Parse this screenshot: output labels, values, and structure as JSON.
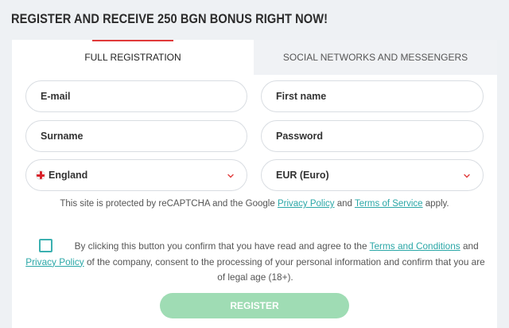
{
  "header": {
    "title": "REGISTER AND RECEIVE 250 BGN BONUS RIGHT NOW!"
  },
  "tabs": [
    {
      "label": "FULL REGISTRATION",
      "active": true
    },
    {
      "label": "SOCIAL NETWORKS AND MESSENGERS",
      "active": false
    }
  ],
  "form": {
    "email_placeholder": "E-mail",
    "first_name_placeholder": "First name",
    "surname_placeholder": "Surname",
    "password_placeholder": "Password",
    "country": {
      "value": "England",
      "icon": "england-flag-icon"
    },
    "currency": {
      "value": "EUR (Euro)"
    }
  },
  "recaptcha": {
    "prefix": "This site is protected by reCAPTCHA and the Google",
    "privacy_link": "Privacy Policy",
    "and": "and",
    "terms_link": "Terms of Service",
    "suffix": "apply."
  },
  "consent": {
    "checked": false,
    "part1": "By clicking this button you confirm that you have read and agree to the",
    "terms_link": "Terms and Conditions",
    "and": "and",
    "privacy_link": "Privacy Policy",
    "part2": "of the company, consent to the processing of your personal information and confirm that you are of legal age (18+)."
  },
  "register_button": "REGISTER",
  "colors": {
    "accent_red": "#e03a3a",
    "link_teal": "#2aa7a7",
    "button_green": "#9fdcb4",
    "background": "#eef1f4"
  }
}
